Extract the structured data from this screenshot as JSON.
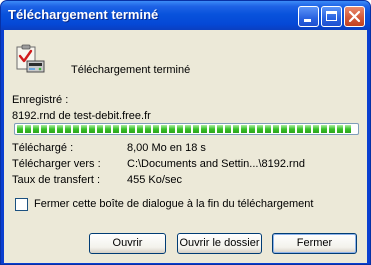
{
  "window": {
    "title": "Téléchargement terminé"
  },
  "titlebar_buttons": [
    "minimize",
    "maximize",
    "close"
  ],
  "header": {
    "text": "Téléchargement terminé",
    "icon": "download-complete-icon"
  },
  "saved": {
    "label": "Enregistré :",
    "value": "8192.rnd de test-debit.free.fr"
  },
  "progress": {
    "percent": 100
  },
  "details": [
    {
      "label": "Téléchargé :",
      "value": "8,00 Mo en 18 s"
    },
    {
      "label": "Télécharger vers :",
      "value": "C:\\Documents and Settin...\\8192.rnd"
    },
    {
      "label": "Taux de transfert :",
      "value": "455 Ko/sec"
    }
  ],
  "close_checkbox": {
    "label": "Fermer cette boîte de dialogue à la fin du téléchargement",
    "checked": false
  },
  "buttons": {
    "open": "Ouvrir",
    "open_folder": "Ouvrir le dossier",
    "close": "Fermer"
  },
  "colors": {
    "titlebar": "#0853dc",
    "progress": "#37c227",
    "dialog_bg": "#ece9d8"
  }
}
